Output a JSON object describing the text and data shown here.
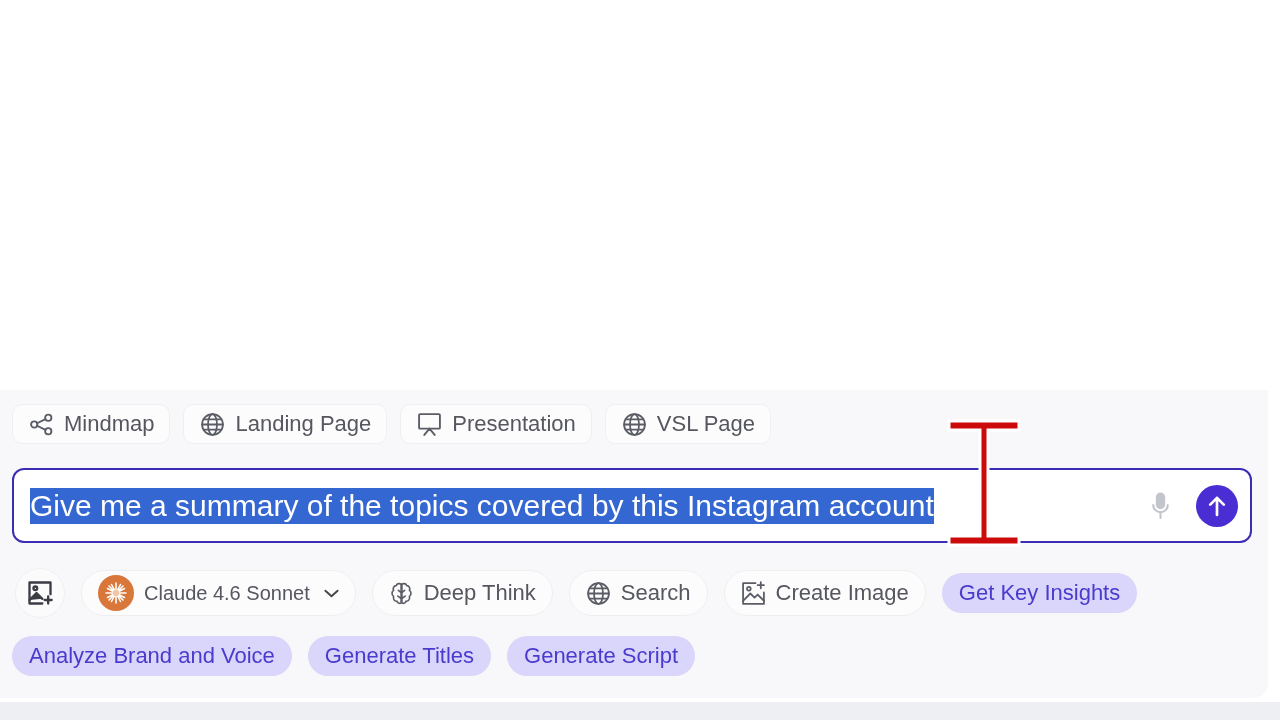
{
  "tools": [
    {
      "kind": "mindmap",
      "label": "Mindmap"
    },
    {
      "kind": "web",
      "label": "Landing Page"
    },
    {
      "kind": "slides",
      "label": "Presentation"
    },
    {
      "kind": "web",
      "label": "VSL Page"
    }
  ],
  "prompt": {
    "value": "Give me a summary of the topics covered by this Instagram account",
    "text_selected": true
  },
  "options": [
    {
      "kind": "attach"
    },
    {
      "kind": "model",
      "label": "Claude 4.6 Sonnet"
    },
    {
      "kind": "think",
      "label": "Deep Think"
    },
    {
      "kind": "search",
      "label": "Search"
    },
    {
      "kind": "image",
      "label": "Create Image"
    }
  ],
  "suggestions": [
    "Get Key Insights",
    "Analyze Brand and Voice",
    "Generate Titles",
    "Generate Script"
  ],
  "pointer": {
    "kind": "ibeam"
  }
}
